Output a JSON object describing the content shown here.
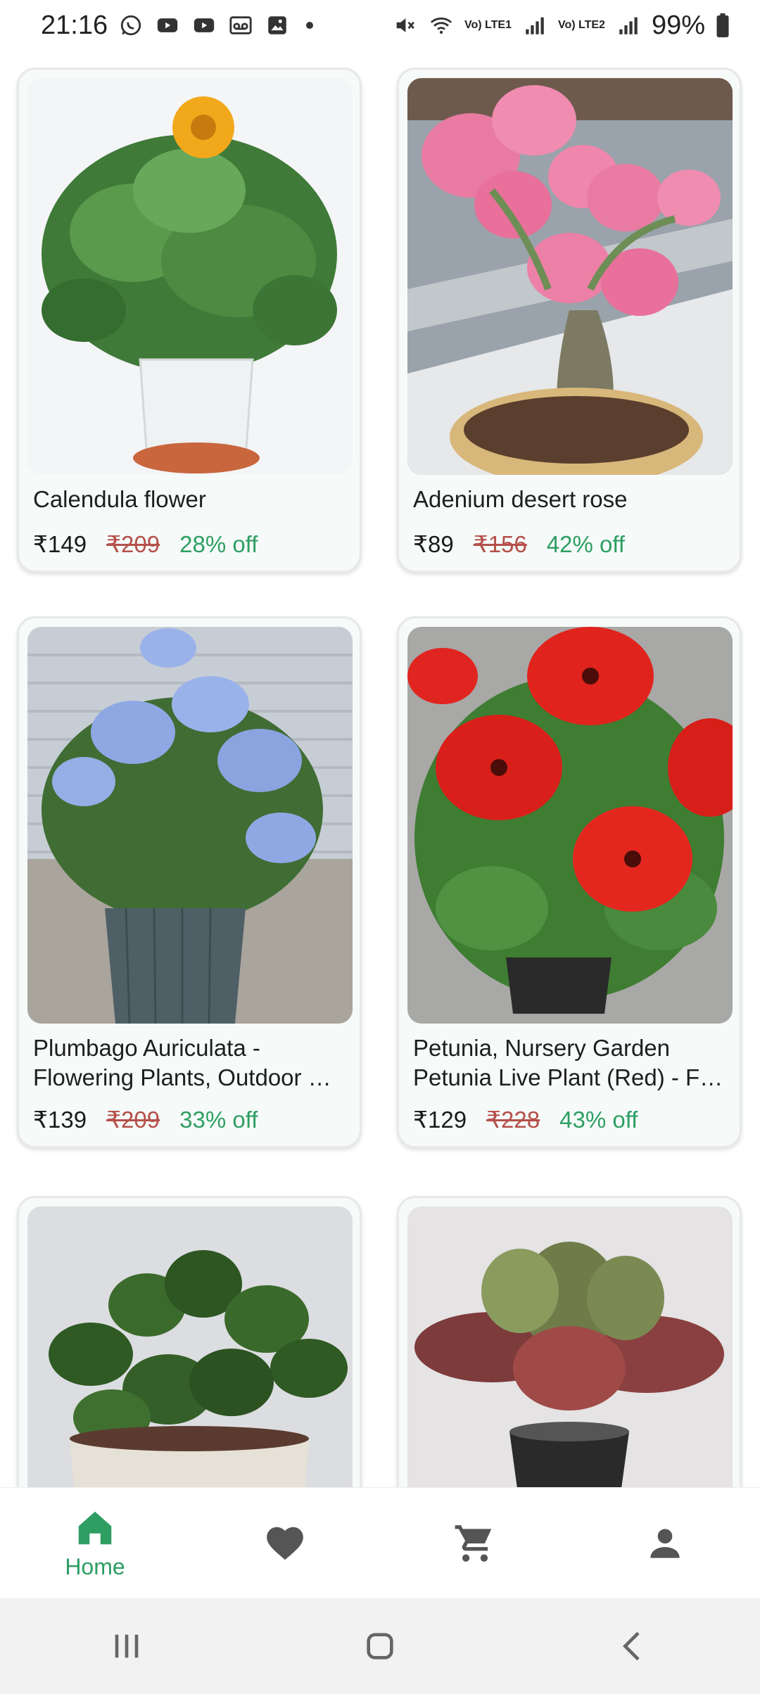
{
  "status_bar": {
    "time": "21:16",
    "battery": "99%",
    "sim1": "Vo) LTE1",
    "sim2": "Vo) LTE2",
    "left_icons": [
      "whatsapp-icon",
      "youtube-icon",
      "youtube-icon",
      "voicemail-icon",
      "gallery-icon"
    ],
    "right_icons": [
      "mute-icon",
      "wifi-icon",
      "signal-icon",
      "signal-icon",
      "battery-icon"
    ]
  },
  "products": [
    {
      "name": "Calendula flower",
      "price": "₹149",
      "mrp": "₹209",
      "discount": "28% off",
      "image": "calendula-photo"
    },
    {
      "name": "Adenium desert rose",
      "price": "₹89",
      "mrp": "₹156",
      "discount": "42% off",
      "image": "adenium-photo"
    },
    {
      "name": "Plumbago Auriculata - Flowering Plants, Outdoor …",
      "price": "₹139",
      "mrp": "₹209",
      "discount": "33% off",
      "image": "plumbago-photo"
    },
    {
      "name": "Petunia, Nursery Garden Petunia Live Plant (Red) - F…",
      "price": "₹129",
      "mrp": "₹228",
      "discount": "43% off",
      "image": "petunia-photo"
    },
    {
      "name": "",
      "price": "",
      "mrp": "",
      "discount": "",
      "image": "peperomia-photo"
    },
    {
      "name": "",
      "price": "",
      "mrp": "",
      "discount": "",
      "image": "kalanchoe-photo"
    }
  ],
  "bottom_nav": {
    "home_label": "Home",
    "items": [
      "home-icon",
      "favorite-icon",
      "cart-icon",
      "profile-icon"
    ],
    "active_color": "#2e9e63",
    "inactive_color": "#555555"
  },
  "colors": {
    "discount": "#2e9e63",
    "mrp_strike": "#b5504a",
    "card_bg": "#f6fbf9"
  }
}
